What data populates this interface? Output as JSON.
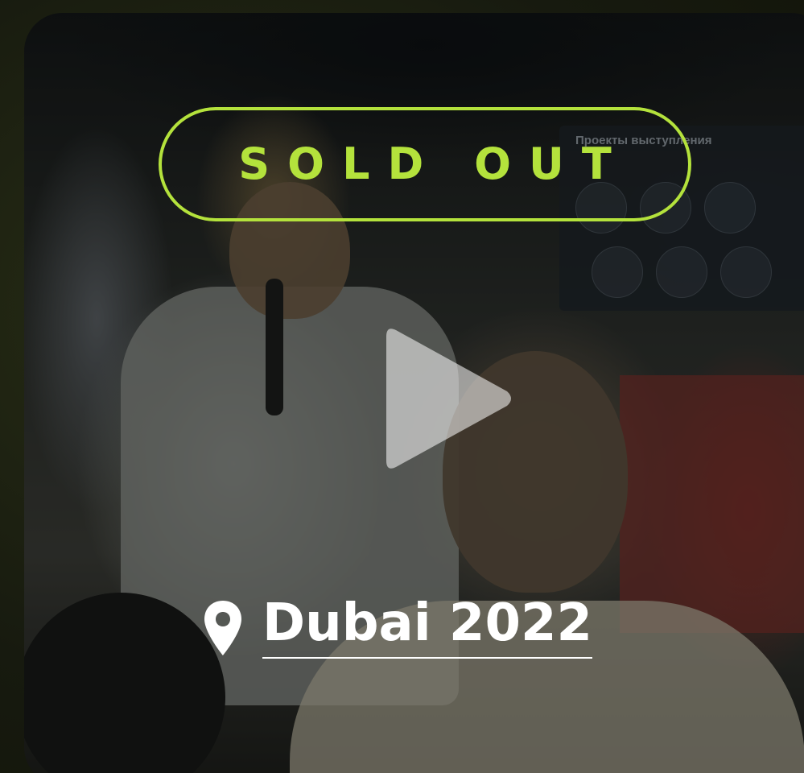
{
  "event_card": {
    "status_badge": "SOLD OUT",
    "location": "Dubai 2022",
    "play_icon": "play-icon",
    "pin_icon": "map-pin-icon",
    "screen_heading": "Проекты выступления",
    "colors": {
      "accent": "#b4e23c",
      "text": "#ffffff",
      "page_background": "#171a0f"
    }
  }
}
